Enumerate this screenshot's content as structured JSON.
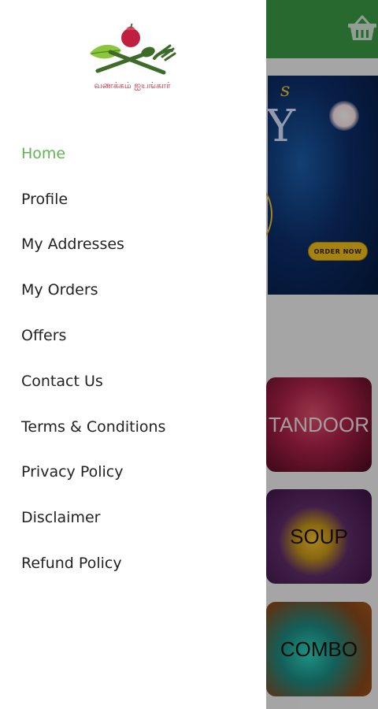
{
  "background": {
    "header_color": "#3a9b46",
    "cart_icon": "basket-icon",
    "banner": {
      "order_button_label": "ORDER NOW",
      "partial_title": "Y",
      "partial_script": "s"
    },
    "categories": [
      {
        "label": "TANDOOR"
      },
      {
        "label": "SOUP"
      },
      {
        "label": "COMBO"
      }
    ]
  },
  "drawer": {
    "logo": {
      "icon": "food-fork-leaf-logo",
      "caption": "வணக்கம் ஐயங்கார்"
    },
    "accent_color": "#5fb550",
    "menu": [
      {
        "label": "Home",
        "active": true
      },
      {
        "label": "Profile",
        "active": false
      },
      {
        "label": "My Addresses",
        "active": false
      },
      {
        "label": "My Orders",
        "active": false
      },
      {
        "label": "Offers",
        "active": false
      },
      {
        "label": "Contact Us",
        "active": false
      },
      {
        "label": "Terms & Conditions",
        "active": false
      },
      {
        "label": "Privacy Policy",
        "active": false
      },
      {
        "label": "Disclaimer",
        "active": false
      },
      {
        "label": "Refund Policy",
        "active": false
      }
    ]
  }
}
